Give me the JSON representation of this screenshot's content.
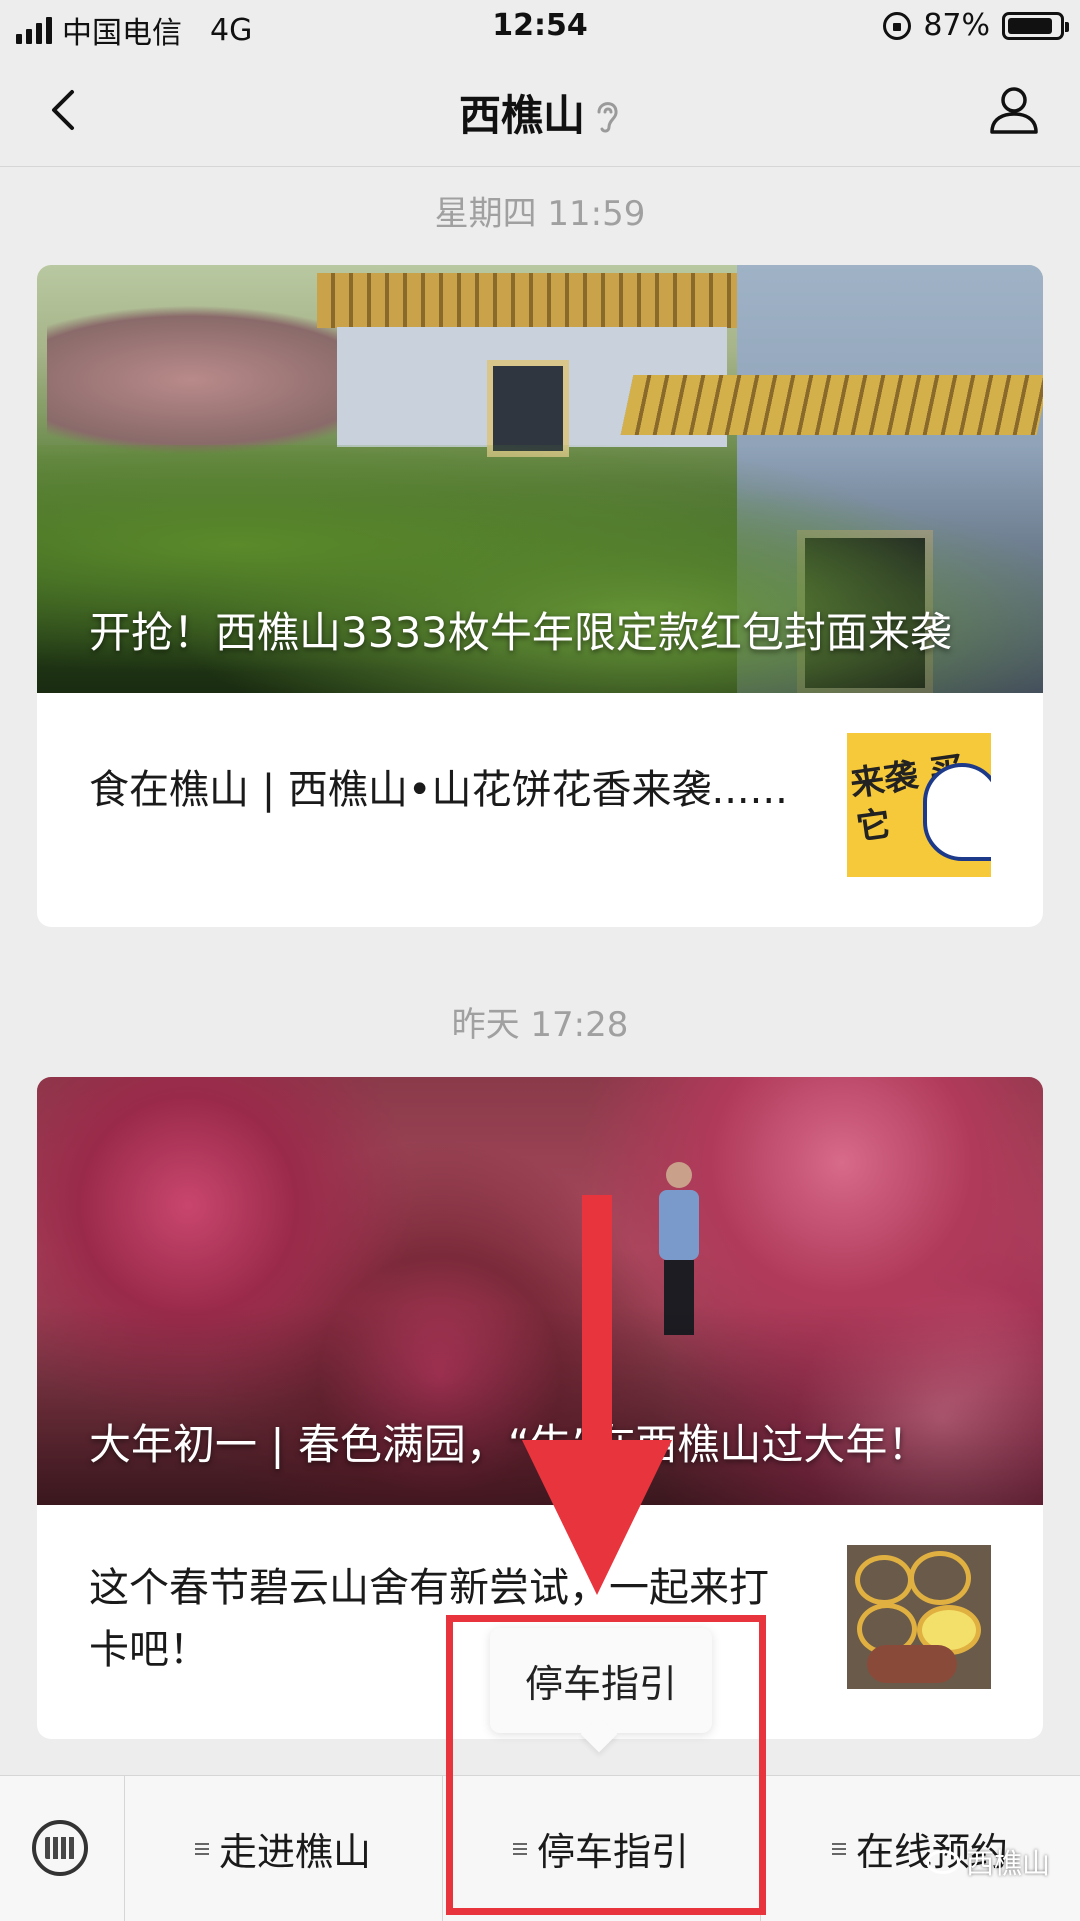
{
  "status_bar": {
    "carrier": "中国电信",
    "network": "4G",
    "time": "12:54",
    "battery": "87%",
    "battery_level": 0.87
  },
  "nav": {
    "title": "西樵山"
  },
  "messages": [
    {
      "timestamp": "星期四 11:59",
      "cover_title": "开抢！西樵山3333枚牛年限定款红包封面来袭",
      "sub_title": "食在樵山 | 西樵山•山花饼花香来袭......",
      "thumb_text": "来袭 买它"
    },
    {
      "timestamp": "昨天 17:28",
      "cover_title": "大年初一 | 春色满园，“牛”在西樵山过大年！",
      "sub_title": "这个春节碧云山舍有新尝试，一起来打卡吧！"
    }
  ],
  "popup": {
    "label": "停车指引"
  },
  "menu": {
    "items": [
      "走进樵山",
      "停车指引",
      "在线预约"
    ]
  },
  "watermark": "西樵山",
  "colors": {
    "annotation_red": "#e8343c",
    "background": "#ededed"
  },
  "icons": {
    "back": "back-chevron-icon",
    "ear": "ear-icon",
    "profile": "profile-icon",
    "keyboard": "keyboard-icon"
  }
}
